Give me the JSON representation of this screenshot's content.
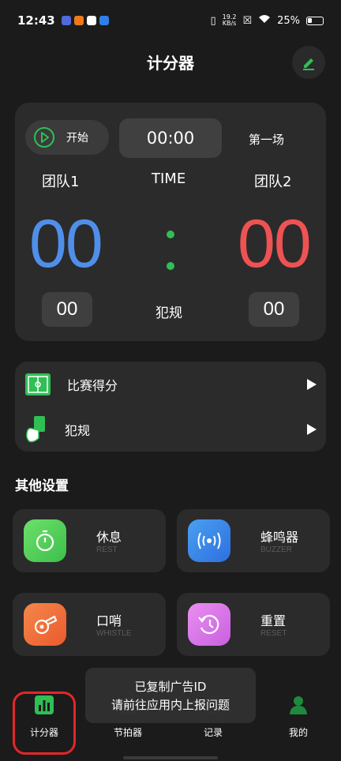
{
  "status": {
    "time": "12:43",
    "netspeed_top": "19.2",
    "netspeed_bottom": "KB/s",
    "battery": "25%"
  },
  "header": {
    "title": "计分器"
  },
  "scoreboard": {
    "start_label": "开始",
    "timer": "00:00",
    "match": "第一场",
    "team1": "团队1",
    "team2": "团队2",
    "time_label": "TIME",
    "score1": "00",
    "score2": "00",
    "foul1": "00",
    "foul2": "00",
    "foul_label": "犯规"
  },
  "list": {
    "items": [
      {
        "label": "比赛得分",
        "icon": "scoreboard-icon"
      },
      {
        "label": "犯规",
        "icon": "foul-card-icon"
      }
    ]
  },
  "other_settings": {
    "title": "其他设置",
    "items": [
      {
        "title": "休息",
        "subtitle": "REST",
        "icon": "stopwatch-icon",
        "color": "#46c95a"
      },
      {
        "title": "蜂鸣器",
        "subtitle": "BUZZER",
        "icon": "buzzer-icon",
        "color": "#3a7fe8"
      },
      {
        "title": "口哨",
        "subtitle": "WHISTLE",
        "icon": "whistle-icon",
        "color": "#f0693a"
      },
      {
        "title": "重置",
        "subtitle": "RESET",
        "icon": "reset-icon",
        "color": "#d86fe8"
      }
    ]
  },
  "tabs": [
    {
      "label": "计分器",
      "icon": "bar-chart-icon",
      "active": true
    },
    {
      "label": "节拍器",
      "icon": "metronome-icon"
    },
    {
      "label": "记录",
      "icon": "record-icon"
    },
    {
      "label": "我的",
      "icon": "person-icon"
    }
  ],
  "toast": {
    "line1": "已复制广告ID",
    "line2": "请前往应用内上报问题"
  },
  "colors": {
    "accent_green": "#2fbf55",
    "team1_blue": "#4f8fea",
    "team2_red": "#ee5253",
    "highlight_red": "#e3262a"
  }
}
